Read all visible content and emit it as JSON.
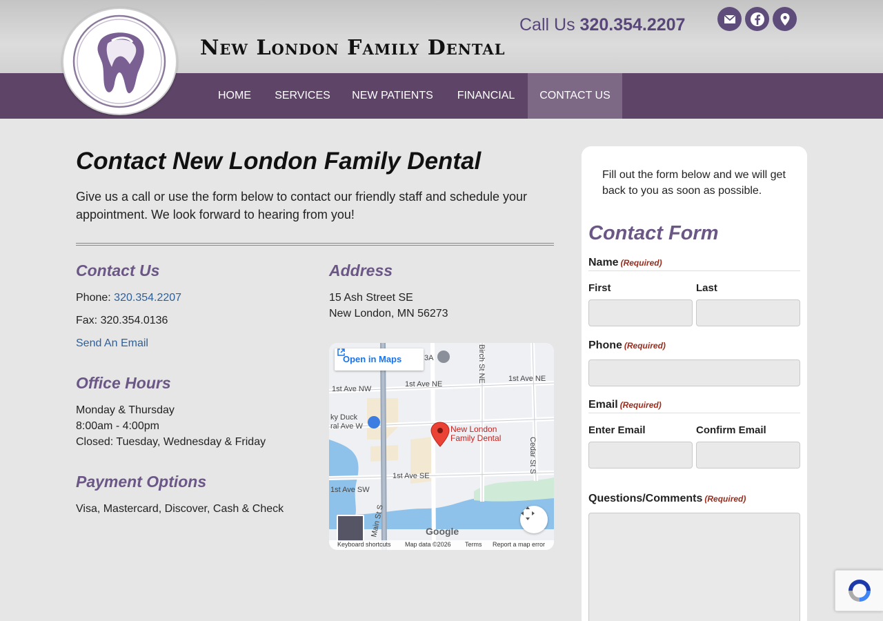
{
  "header": {
    "brand": "New London Family Dental",
    "call_prefix": "Call Us",
    "phone": "320.354.2207",
    "social_icons": [
      "email-icon",
      "facebook-icon",
      "map-pin-icon"
    ]
  },
  "nav": {
    "items": [
      "HOME",
      "SERVICES",
      "NEW PATIENTS",
      "FINANCIAL",
      "CONTACT US"
    ],
    "active": "CONTACT US"
  },
  "main": {
    "title": "Contact New London Family Dental",
    "intro": "Give us a call or use the form below to contact our friendly staff and schedule your appointment. We look forward to hearing from you!",
    "contact": {
      "heading": "Contact Us",
      "phone_label": "Phone:",
      "phone": "320.354.2207",
      "fax": "Fax: 320.354.0136",
      "email_link": "Send An Email"
    },
    "hours": {
      "heading": "Office Hours",
      "line1": "Monday & Thursday",
      "line2": "8:00am - 4:00pm",
      "line3": "Closed: Tuesday, Wednesday & Friday"
    },
    "payment": {
      "heading": "Payment Options",
      "text": "Visa, Mastercard, Discover, Cash & Check"
    },
    "address": {
      "heading": "Address",
      "line1": "15 Ash Street SE",
      "line2": "New London, MN 56273"
    }
  },
  "map": {
    "open_label": "Open in Maps",
    "marker_label_1": "New London",
    "marker_label_2": "Family Dental",
    "streets": [
      "1st Ave NW",
      "1st Ave NE",
      "1st Ave NE",
      "Birch St NE",
      "Cedar St S",
      "ral Ave W",
      "1st Ave SE",
      "1st Ave SW",
      "Main St S",
      "ky Duck",
      "3A"
    ],
    "google": "Google",
    "footer": [
      "Keyboard shortcuts",
      "Map data ©2026",
      "Terms",
      "Report a map error"
    ]
  },
  "form": {
    "intro": "Fill out the form below and we will get back to you as soon as possible.",
    "title": "Contact Form",
    "required": "(Required)",
    "name_label": "Name",
    "first_label": "First",
    "last_label": "Last",
    "phone_label": "Phone",
    "email_label": "Email",
    "enter_email_label": "Enter Email",
    "confirm_email_label": "Confirm Email",
    "comments_label": "Questions/Comments",
    "first_value": "",
    "last_value": "",
    "phone_value": "",
    "email_value": "",
    "confirm_value": "",
    "comments_value": ""
  },
  "colors": {
    "nav_bg": "#5e4568",
    "nav_active": "#7d6886",
    "accent_purple": "#6b5785",
    "link_blue": "#2d5f9a",
    "required_red": "#9b2a1a"
  }
}
